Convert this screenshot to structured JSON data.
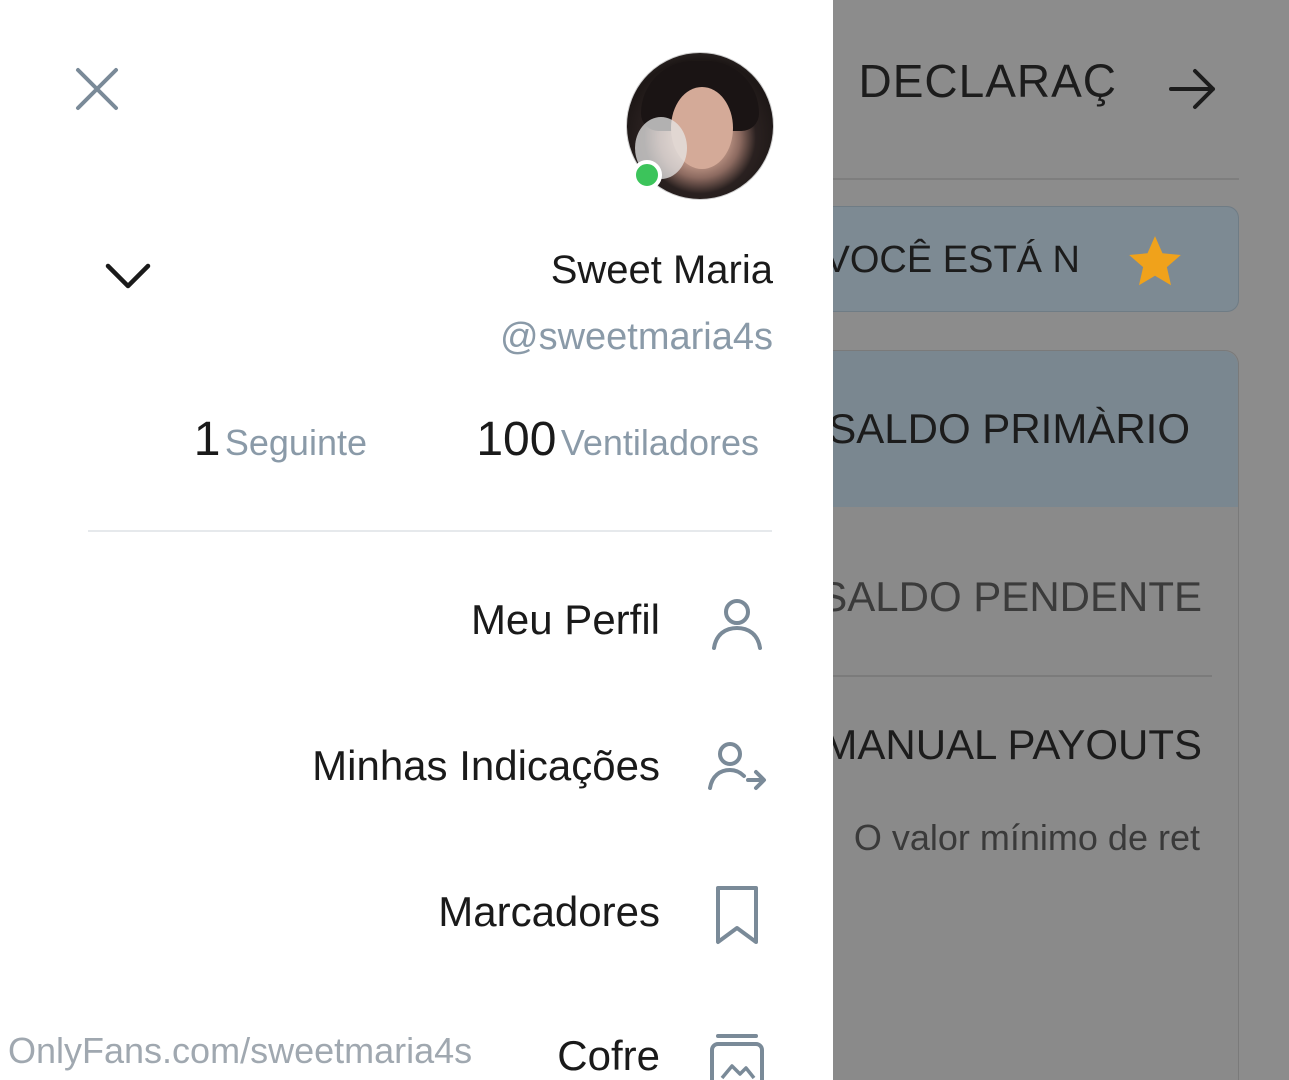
{
  "background_page": {
    "title": "DECLARAÇ",
    "notice_text": "VOCÊ ESTÁ N",
    "primary_balance_label": "SALDO PRIMÀRIO",
    "pending_balance_label": "SALDO PENDENTE",
    "manual_payouts_label": "MANUAL PAYOUTS",
    "minimum_text": "O valor mínimo de ret",
    "notice_color": "#7d8a93",
    "star_color": "#f0a21b"
  },
  "drawer": {
    "user": {
      "display_name": "Sweet Maria",
      "handle": "@sweetmaria4s",
      "online_color": "#3cc45b"
    },
    "stats": {
      "fans_count": "100",
      "fans_label": "Ventiladores",
      "following_count": "1",
      "following_label": "Seguinte"
    },
    "menu": [
      {
        "label": "Meu Perfil",
        "icon": "user-icon"
      },
      {
        "label": "Minhas Indicações",
        "icon": "referral-icon"
      },
      {
        "label": "Marcadores",
        "icon": "bookmark-icon"
      },
      {
        "label": "Cofre",
        "icon": "vault-icon"
      }
    ],
    "watermark": "OnlyFans.com/sweetmaria4s"
  }
}
